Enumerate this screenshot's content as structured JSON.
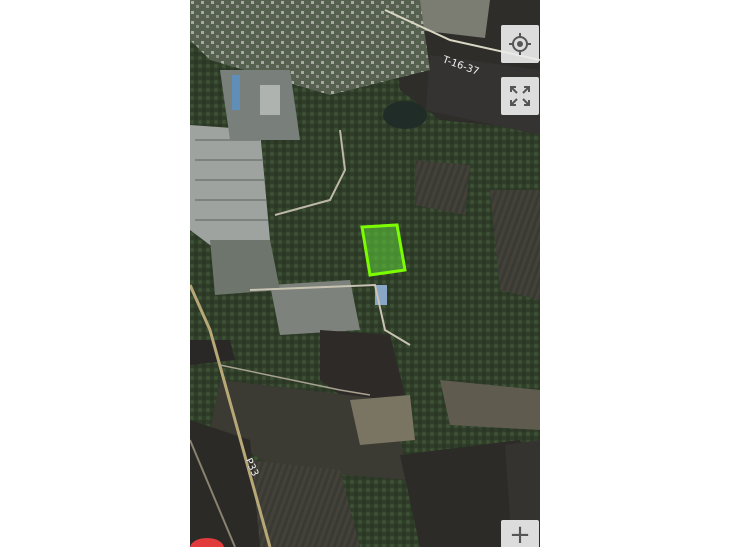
{
  "map": {
    "view": "satellite",
    "road_labels": [
      "T-16-37",
      "P33"
    ],
    "highlight_color": "#7CFC00"
  },
  "controls": {
    "locate_icon": "crosshair-target-icon",
    "fullscreen_icon": "expand-corners-icon",
    "zoom_in_label": "+"
  }
}
